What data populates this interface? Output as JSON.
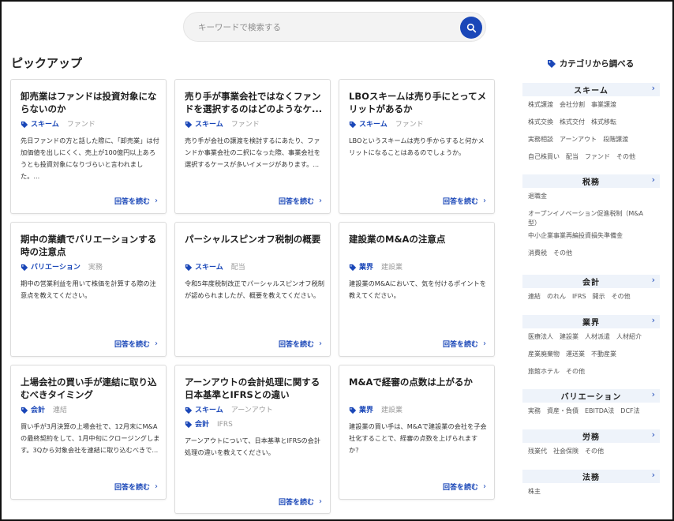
{
  "search": {
    "placeholder": "キーワードで検索する"
  },
  "pickup": {
    "title": "ピックアップ"
  },
  "read_label": "回答を読む",
  "cards": [
    {
      "title": "卸売業はファンドは投資対象にならないのか",
      "tags": [
        [
          "スキーム",
          "ファンド"
        ]
      ],
      "desc": "先日ファンドの方と話した際に、「卸売業」は付加価値を出しにくく、売上が100億円以上あろうとも投資対象になりづらいと言われました。..."
    },
    {
      "title": "売り手が事業会社ではなくファンドを選択するのはどのようなケ...",
      "tags": [
        [
          "スキーム",
          "ファンド"
        ]
      ],
      "desc": "売り手が会社の譲渡を検討するにあたり、ファンドか事業会社の二択になった際、事業会社を選択するケースが多いイメージがあります。..."
    },
    {
      "title": "LBOスキームは売り手にとってメリットがあるか",
      "tags": [
        [
          "スキーム",
          "ファンド"
        ]
      ],
      "desc": "LBOというスキームは売り手からすると何かメリットになることはあるのでしょうか。"
    },
    {
      "title": "期中の業績でバリエーションする時の注意点",
      "tags": [
        [
          "バリエーション",
          "実務"
        ]
      ],
      "desc": "期中の営業利益を用いて株価を計算する際の注意点を教えてください。"
    },
    {
      "title": "パーシャルスピンオフ税制の概要",
      "tags": [
        [
          "スキーム",
          "配当"
        ]
      ],
      "desc": "令和5年度税制改正でパーシャルスピンオフ税制が認められましたが、概要を教えてください。"
    },
    {
      "title": "建設業のM&Aの注意点",
      "tags": [
        [
          "業界",
          "建設業"
        ]
      ],
      "desc": "建設業のM&Aにおいて、気を付けるポイントを教えてください。"
    },
    {
      "title": "上場会社の買い手が連結に取り込むべきタイミング",
      "tags": [
        [
          "会計",
          "連結"
        ]
      ],
      "desc": "買い手が3月決算の上場会社で、12月末にM&Aの最終契約をして、1月中旬にクロージングします。3Qから対象会社を連結に取り込むべきで..."
    },
    {
      "title": "アーンアウトの会計処理に関する日本基準とIFRSとの違い",
      "tags": [
        [
          "スキーム",
          "アーンアウト"
        ],
        [
          "会計",
          "IFRS"
        ]
      ],
      "desc": "アーンアウトについて、日本基準とIFRSの会計処理の違いを教えてください。"
    },
    {
      "title": "M&Aで経審の点数は上がるか",
      "tags": [
        [
          "業界",
          "建設業"
        ]
      ],
      "desc": "建設業の買い手は、M&Aで建設業の会社を子会社化することで、経審の点数を上げられますか？"
    }
  ],
  "sidebar": {
    "title": "カテゴリから調べる",
    "categories": [
      {
        "name": "スキーム",
        "lines": [
          [
            "株式譲渡",
            "会社分割",
            "事業譲渡"
          ],
          [
            "株式交換",
            "株式交付",
            "株式移転"
          ],
          [
            "実務相談",
            "アーンアウト",
            "段階譲渡"
          ],
          [
            "自己株買い",
            "配当",
            "ファンド",
            "その他"
          ]
        ]
      },
      {
        "name": "税務",
        "lines": [
          [
            "退職金"
          ],
          [
            "オープンイノベーション促進税制（M&A型）"
          ],
          [
            "中小企業事業再編投資損失準備金"
          ],
          [
            "消費税",
            "その他"
          ]
        ]
      },
      {
        "name": "会計",
        "lines": [
          [
            "連結",
            "のれん",
            "IFRS",
            "開示",
            "その他"
          ]
        ]
      },
      {
        "name": "業界",
        "lines": [
          [
            "医療法人",
            "建設業",
            "人材派遣",
            "人材紹介"
          ],
          [
            "産業廃棄物",
            "運送業",
            "不動産業"
          ],
          [
            "旅館ホテル",
            "その他"
          ]
        ]
      },
      {
        "name": "バリエーション",
        "lines": [
          [
            "実務",
            "資産・負債",
            "EBITDA法",
            "DCF法"
          ]
        ]
      },
      {
        "name": "労務",
        "lines": [
          [
            "残業代",
            "社会保険",
            "その他"
          ]
        ]
      },
      {
        "name": "法務",
        "lines": [
          [
            "株主"
          ]
        ]
      }
    ]
  },
  "colors": {
    "accent": "#1a47b8",
    "muted": "#9a9a9a",
    "category_bg": "#eef3fa"
  }
}
